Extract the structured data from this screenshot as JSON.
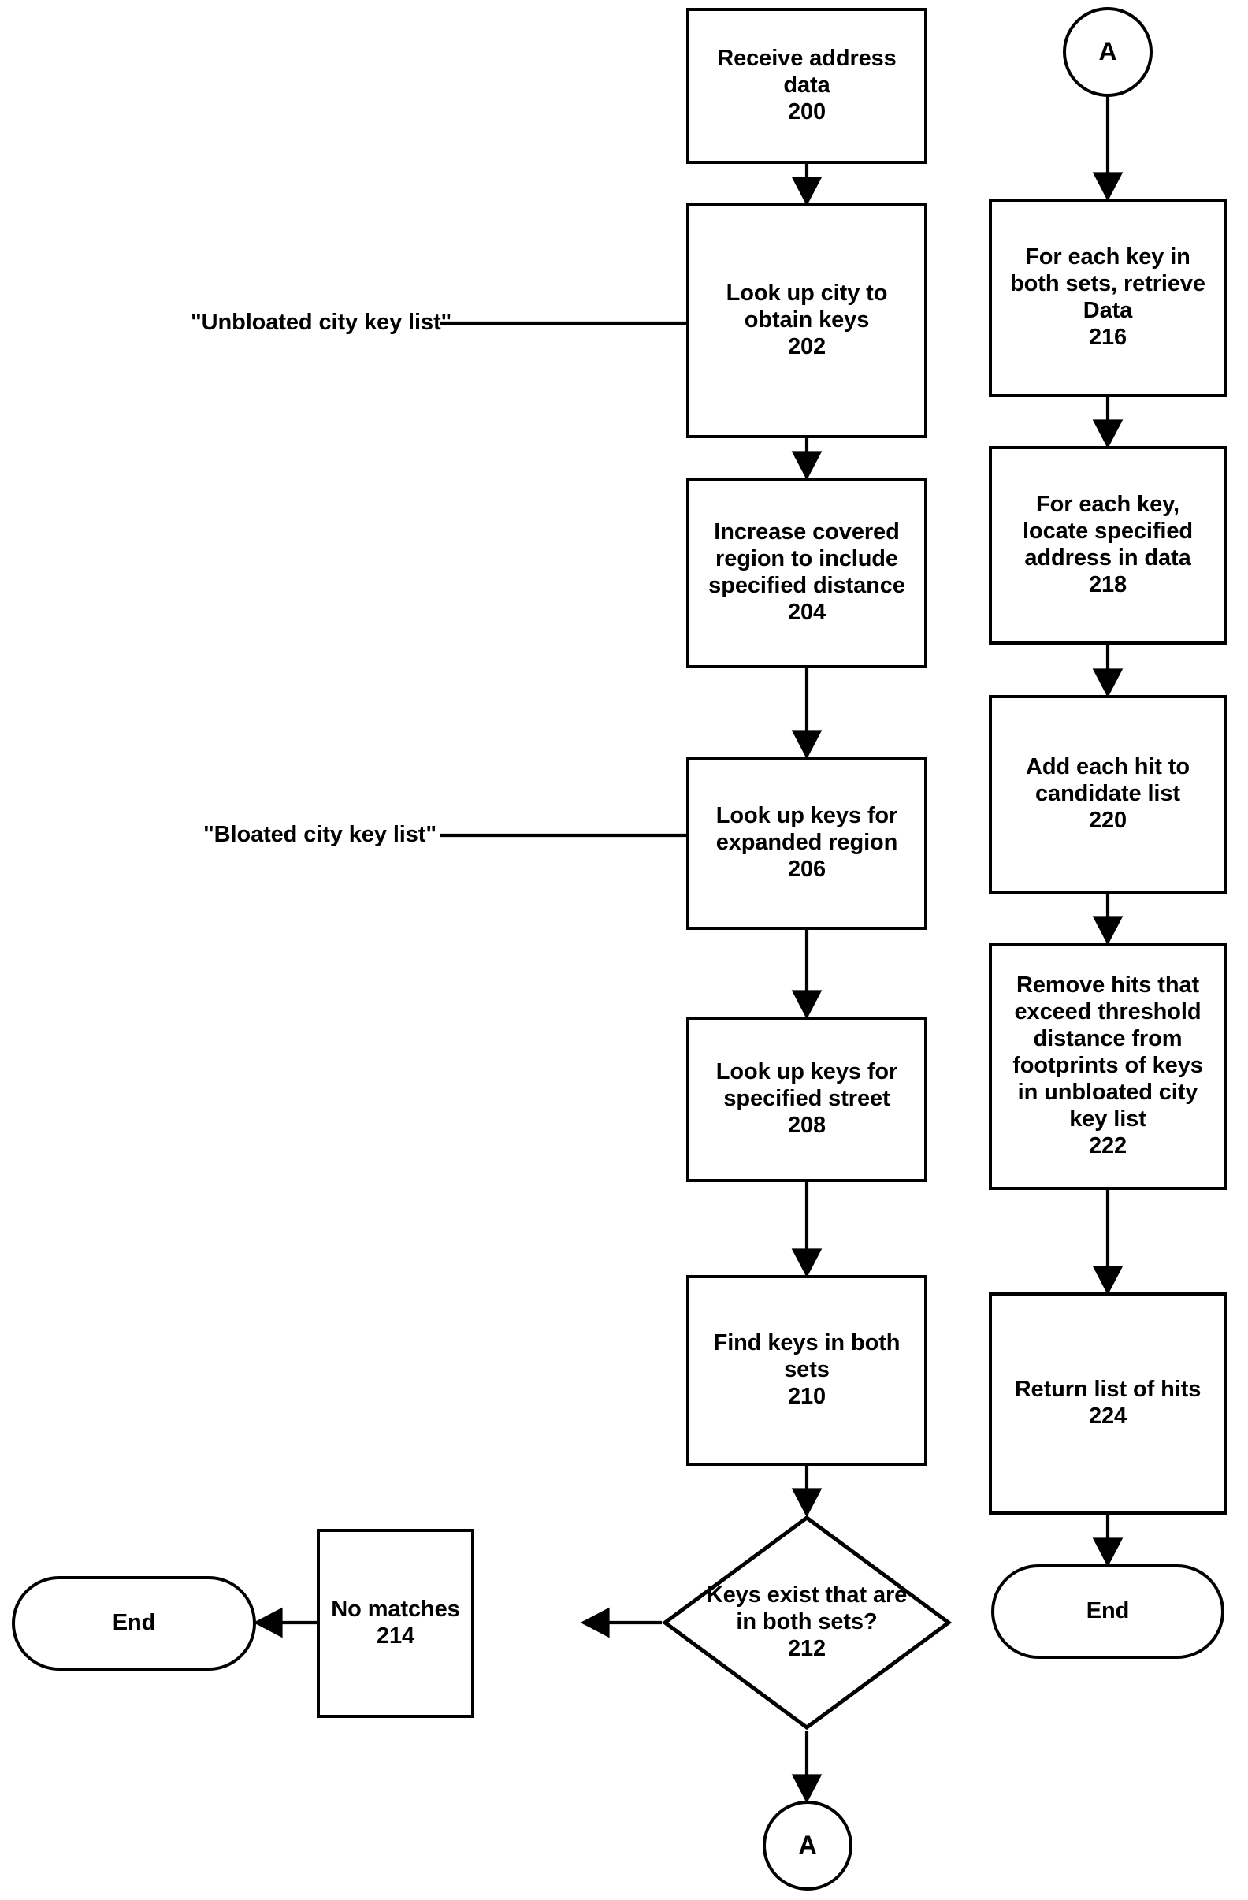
{
  "diagram": {
    "type": "flowchart",
    "title": "",
    "background_color": "#ffffff",
    "line_color": "#000000",
    "text_color": "#000000"
  },
  "nodes": {
    "n200": {
      "text": "Receive address\ndata\n200",
      "shape": "process",
      "ref": "200"
    },
    "n202": {
      "text": "Look up city to\nobtain keys\n202",
      "shape": "process",
      "ref": "202"
    },
    "n204": {
      "text": "Increase covered\nregion to include\nspecified distance\n204",
      "shape": "process",
      "ref": "204"
    },
    "n206": {
      "text": "Look up keys for\nexpanded region\n206",
      "shape": "process",
      "ref": "206"
    },
    "n208": {
      "text": "Look up keys for\nspecified street\n208",
      "shape": "process",
      "ref": "208"
    },
    "n210": {
      "text": "Find keys in both\nsets\n210",
      "shape": "process",
      "ref": "210"
    },
    "n212": {
      "text": "Keys exist that are\nin both sets?\n212",
      "shape": "decision",
      "ref": "212"
    },
    "n214": {
      "text": "No matches\n214",
      "shape": "process",
      "ref": "214"
    },
    "n216": {
      "text": "For each key in\nboth sets, retrieve\nData\n216",
      "shape": "process",
      "ref": "216"
    },
    "n218": {
      "text": "For each key,\nlocate specified\naddress in data\n218",
      "shape": "process",
      "ref": "218"
    },
    "n220": {
      "text": "Add each hit to\ncandidate list\n220",
      "shape": "process",
      "ref": "220"
    },
    "n222": {
      "text": "Remove hits that\nexceed threshold\ndistance from\nfootprints of keys\nin unbloated city\nkey list\n222",
      "shape": "process",
      "ref": "222"
    },
    "n224": {
      "text": "Return list of hits\n224",
      "shape": "process",
      "ref": "224"
    },
    "end_left": {
      "text": "End",
      "shape": "terminator",
      "ref": ""
    },
    "end_right": {
      "text": "End",
      "shape": "terminator",
      "ref": ""
    },
    "connector_a_top": {
      "text": "A",
      "shape": "connector",
      "ref": "A"
    },
    "connector_a_bottom": {
      "text": "A",
      "shape": "connector",
      "ref": "A"
    }
  },
  "annotations": {
    "unbloated": "\"Unbloated city key list\"",
    "bloated": "\"Bloated city key list\""
  },
  "edges": [
    {
      "from": "n200",
      "to": "n202",
      "label": ""
    },
    {
      "from": "n202",
      "to": "n204",
      "label": ""
    },
    {
      "from": "n204",
      "to": "n206",
      "label": ""
    },
    {
      "from": "n206",
      "to": "n208",
      "label": ""
    },
    {
      "from": "n208",
      "to": "n210",
      "label": ""
    },
    {
      "from": "n210",
      "to": "n212",
      "label": ""
    },
    {
      "from": "n212",
      "to": "n214",
      "label": ""
    },
    {
      "from": "n214",
      "to": "end_left",
      "label": ""
    },
    {
      "from": "n212",
      "to": "connector_a_bottom",
      "label": ""
    },
    {
      "from": "connector_a_top",
      "to": "n216",
      "label": ""
    },
    {
      "from": "n216",
      "to": "n218",
      "label": ""
    },
    {
      "from": "n218",
      "to": "n220",
      "label": ""
    },
    {
      "from": "n220",
      "to": "n222",
      "label": ""
    },
    {
      "from": "n222",
      "to": "n224",
      "label": ""
    },
    {
      "from": "n224",
      "to": "end_right",
      "label": ""
    },
    {
      "from": "unbloated-annotation",
      "to": "n202",
      "label": ""
    },
    {
      "from": "bloated-annotation",
      "to": "n206",
      "label": ""
    }
  ]
}
